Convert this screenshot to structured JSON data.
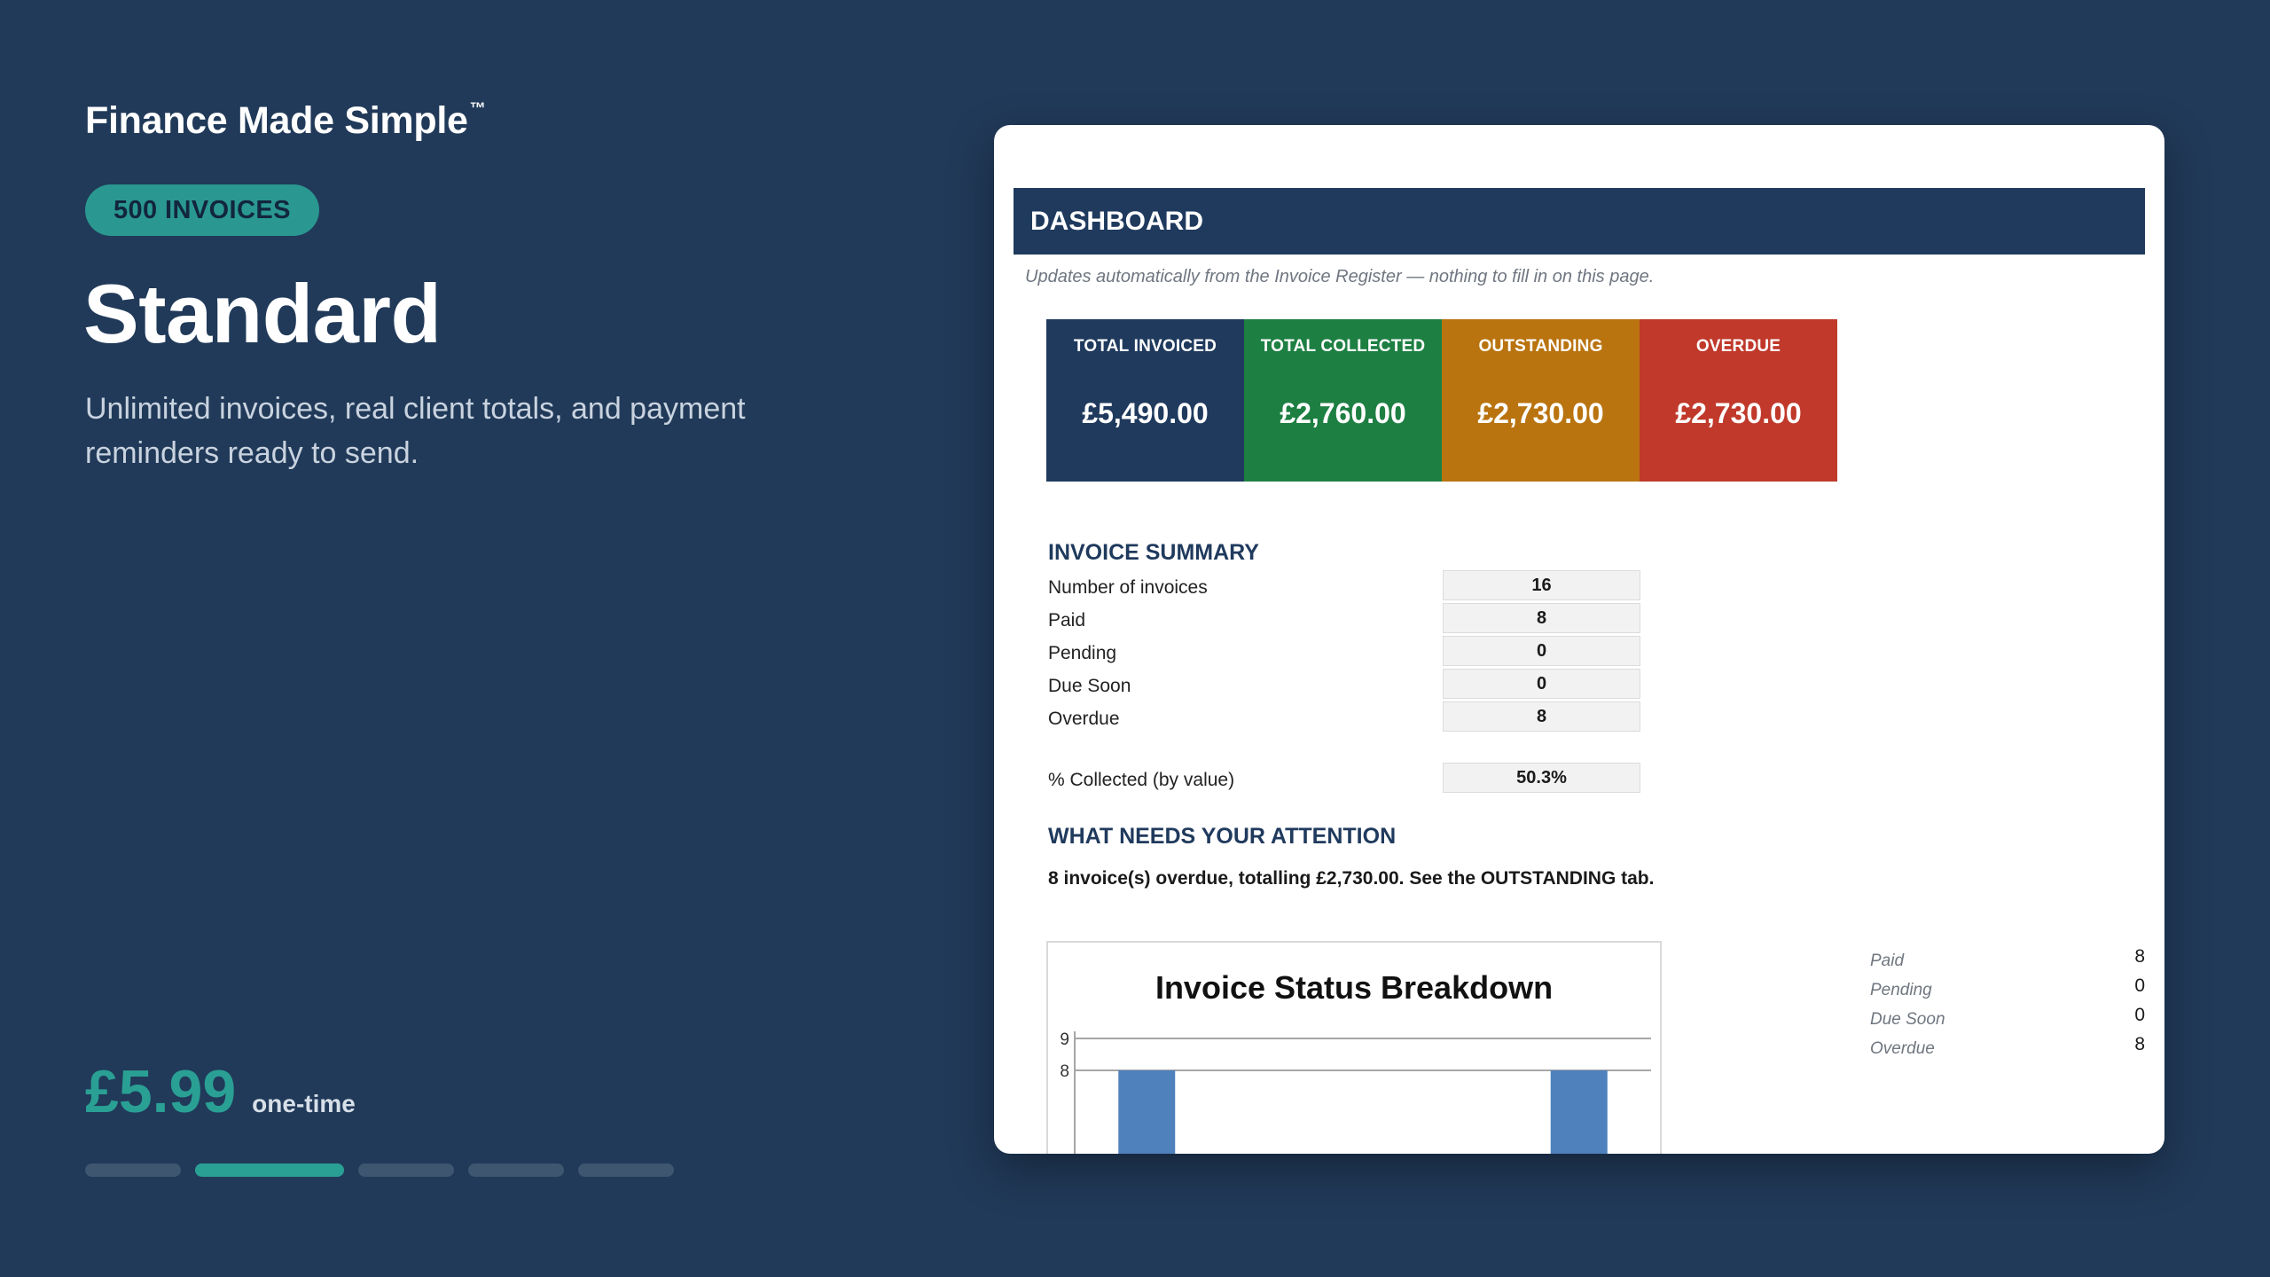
{
  "promo": {
    "brand": "Finance Made Simple",
    "trademark": "™",
    "tier_badge": "500 INVOICES",
    "plan_name": "Standard",
    "description": "Unlimited invoices, real client totals, and payment reminders ready to send.",
    "price": "£5.99",
    "price_note": "one-time",
    "carousel": {
      "total": 5,
      "active_index": 1
    }
  },
  "dashboard": {
    "title": "DASHBOARD",
    "note": "Updates automatically from the Invoice Register — nothing to fill in on this page.",
    "kpis": [
      {
        "label": "TOTAL INVOICED",
        "value": "£5,490.00",
        "color": "#1f3a5d"
      },
      {
        "label": "TOTAL COLLECTED",
        "value": "£2,760.00",
        "color": "#1e7f43"
      },
      {
        "label": "OUTSTANDING",
        "value": "£2,730.00",
        "color": "#b9730f"
      },
      {
        "label": "OVERDUE",
        "value": "£2,730.00",
        "color": "#c0392b"
      }
    ],
    "summary_title": "INVOICE SUMMARY",
    "summary_rows": [
      {
        "label": "Number of invoices",
        "value": "16"
      },
      {
        "label": "Paid",
        "value": "8"
      },
      {
        "label": "Pending",
        "value": "0"
      },
      {
        "label": "Due Soon",
        "value": "0"
      },
      {
        "label": "Overdue",
        "value": "8"
      }
    ],
    "collected": {
      "label": "% Collected (by value)",
      "value": "50.3%"
    },
    "attention_title": "WHAT NEEDS YOUR ATTENTION",
    "attention_message": "8 invoice(s) overdue, totalling £2,730.00. See the OUTSTANDING tab.",
    "legend_rows": [
      {
        "label": "Paid",
        "value": "8"
      },
      {
        "label": "Pending",
        "value": "0"
      },
      {
        "label": "Due Soon",
        "value": "0"
      },
      {
        "label": "Overdue",
        "value": "8"
      }
    ]
  },
  "chart_data": {
    "type": "bar",
    "title": "Invoice Status Breakdown",
    "categories": [
      "Paid",
      "Pending",
      "Due Soon",
      "Overdue"
    ],
    "values": [
      8,
      0,
      0,
      8
    ],
    "visible_ticks": [
      "9",
      "8"
    ],
    "bar_color": "#4f81bd"
  }
}
